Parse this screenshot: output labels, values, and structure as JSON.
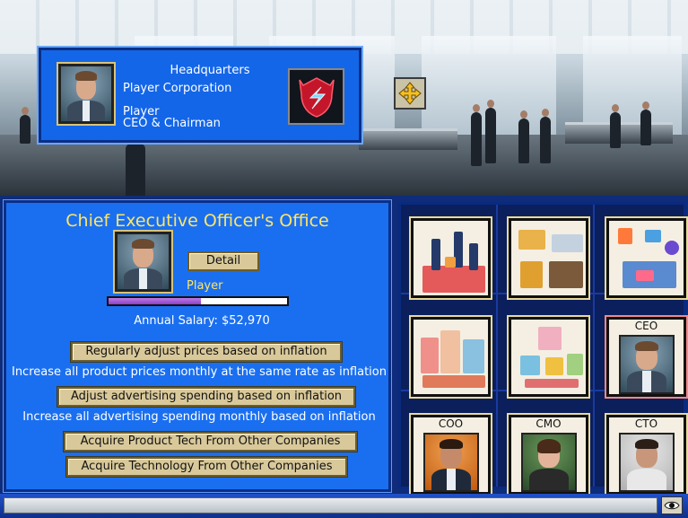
{
  "hq": {
    "title": "Headquarters",
    "corporation": "Player Corporation",
    "player_name": "Player",
    "role": "CEO & Chairman"
  },
  "office": {
    "title": "Chief Executive Officer's Office",
    "detail_label": "Detail",
    "name": "Player",
    "salary_progress": 0.52,
    "salary_text": "Annual Salary: $52,970",
    "actions": [
      {
        "label": "Regularly adjust prices based on inflation",
        "desc": "Increase all product prices monthly at the same rate as inflation"
      },
      {
        "label": "Adjust advertising spending based on inflation",
        "desc": "Increase all advertising spending monthly based on inflation"
      },
      {
        "label": "Acquire Product Tech From Other Companies"
      },
      {
        "label": "Acquire Technology From Other Companies"
      }
    ]
  },
  "grid": {
    "ceo_label": "CEO",
    "coo_label": "COO",
    "cmo_label": "CMO",
    "cto_label": "CTO"
  },
  "colors": {
    "panel_blue": "#1a6ff0",
    "title_yellow": "#ffe566",
    "button_gold": "#d9c99a"
  },
  "icons": {
    "move": "move-arrows-icon",
    "eye": "eye-icon",
    "logo": "corporation-logo"
  }
}
